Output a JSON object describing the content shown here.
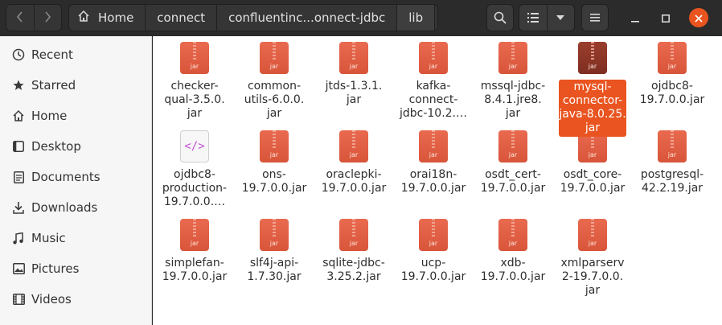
{
  "header": {
    "breadcrumbs": [
      "Home",
      "connect",
      "confluentinc...onnect-jdbc",
      "lib"
    ],
    "icons": {
      "back": "chevron-left-icon",
      "forward": "chevron-right-icon",
      "home": "home-icon",
      "menu": "chevron-down-icon",
      "search": "search-icon",
      "view": "list-view-icon",
      "view_options": "chevron-down-icon",
      "hamburger": "hamburger-icon",
      "minimize": "minimize-icon",
      "maximize": "maximize-icon",
      "close": "close-icon"
    }
  },
  "sidebar": {
    "items": [
      {
        "label": "Recent",
        "icon": "clock-icon"
      },
      {
        "label": "Starred",
        "icon": "star-icon"
      },
      {
        "label": "Home",
        "icon": "home-icon"
      },
      {
        "label": "Desktop",
        "icon": "desktop-icon"
      },
      {
        "label": "Documents",
        "icon": "document-icon"
      },
      {
        "label": "Downloads",
        "icon": "download-icon"
      },
      {
        "label": "Music",
        "icon": "music-icon"
      },
      {
        "label": "Pictures",
        "icon": "picture-icon"
      },
      {
        "label": "Videos",
        "icon": "video-icon"
      }
    ]
  },
  "files": [
    {
      "name": "checker-qual-3.5.0.jar",
      "lines": [
        "checker-",
        "qual-3.5.0.",
        "jar"
      ],
      "type": "jar",
      "icon_label": "jar"
    },
    {
      "name": "common-utils-6.0.0.jar",
      "lines": [
        "common-",
        "utils-6.0.0.",
        "jar"
      ],
      "type": "jar",
      "icon_label": "jar"
    },
    {
      "name": "jtds-1.3.1.jar",
      "lines": [
        "jtds-1.3.1.",
        "jar"
      ],
      "type": "jar",
      "icon_label": "jar"
    },
    {
      "name": "kafka-connect-jdbc-10.2....",
      "lines": [
        "kafka-",
        "connect-",
        "jdbc-10.2.…"
      ],
      "type": "jar",
      "icon_label": "jar"
    },
    {
      "name": "mssql-jdbc-8.4.1.jre8.jar",
      "lines": [
        "mssql-jdbc-",
        "8.4.1.jre8.",
        "jar"
      ],
      "type": "jar",
      "icon_label": "jar"
    },
    {
      "name": "mysql-connector-java-8.0.25.jar",
      "lines": [
        "mysql-",
        "connector-",
        "java-8.0.25.",
        "jar"
      ],
      "type": "jar",
      "icon_label": "jar",
      "selected": true
    },
    {
      "name": "ojdbc8-19.7.0.0.jar",
      "lines": [
        "ojdbc8-",
        "19.7.0.0.jar"
      ],
      "type": "jar",
      "icon_label": "jar"
    },
    {
      "name": "ojdbc8-production-19.7.0.0....",
      "lines": [
        "ojdbc8-",
        "production-",
        "19.7.0.0.…"
      ],
      "type": "xml",
      "icon_label": "</>"
    },
    {
      "name": "ons-19.7.0.0.jar",
      "lines": [
        "ons-",
        "19.7.0.0.jar"
      ],
      "type": "jar",
      "icon_label": "jar"
    },
    {
      "name": "oraclepki-19.7.0.0.jar",
      "lines": [
        "oraclepki-",
        "19.7.0.0.jar"
      ],
      "type": "jar",
      "icon_label": "jar"
    },
    {
      "name": "orai18n-19.7.0.0.jar",
      "lines": [
        "orai18n-",
        "19.7.0.0.jar"
      ],
      "type": "jar",
      "icon_label": "jar"
    },
    {
      "name": "osdt_cert-19.7.0.0.jar",
      "lines": [
        "osdt_cert-",
        "19.7.0.0.jar"
      ],
      "type": "jar",
      "icon_label": "jar"
    },
    {
      "name": "osdt_core-19.7.0.0.jar",
      "lines": [
        "osdt_core-",
        "19.7.0.0.jar"
      ],
      "type": "jar",
      "icon_label": "jar"
    },
    {
      "name": "postgresql-42.2.19.jar",
      "lines": [
        "postgresql-",
        "42.2.19.jar"
      ],
      "type": "jar",
      "icon_label": "jar"
    },
    {
      "name": "simplefan-19.7.0.0.jar",
      "lines": [
        "simplefan-",
        "19.7.0.0.jar"
      ],
      "type": "jar",
      "icon_label": "jar"
    },
    {
      "name": "slf4j-api-1.7.30.jar",
      "lines": [
        "slf4j-api-",
        "1.7.30.jar"
      ],
      "type": "jar",
      "icon_label": "jar"
    },
    {
      "name": "sqlite-jdbc-3.25.2.jar",
      "lines": [
        "sqlite-jdbc-",
        "3.25.2.jar"
      ],
      "type": "jar",
      "icon_label": "jar"
    },
    {
      "name": "ucp-19.7.0.0.jar",
      "lines": [
        "ucp-",
        "19.7.0.0.jar"
      ],
      "type": "jar",
      "icon_label": "jar"
    },
    {
      "name": "xdb-19.7.0.0.jar",
      "lines": [
        "xdb-",
        "19.7.0.0.jar"
      ],
      "type": "jar",
      "icon_label": "jar"
    },
    {
      "name": "xmlparserv2-19.7.0.0.jar",
      "lines": [
        "xmlparserv",
        "2-19.7.0.0.",
        "jar"
      ],
      "type": "jar",
      "icon_label": "jar"
    }
  ],
  "colors": {
    "accent": "#e95420",
    "jar_icon": "#e0603f",
    "headerbar": "#2b2b2b",
    "sidebar": "#f6f6f6"
  }
}
